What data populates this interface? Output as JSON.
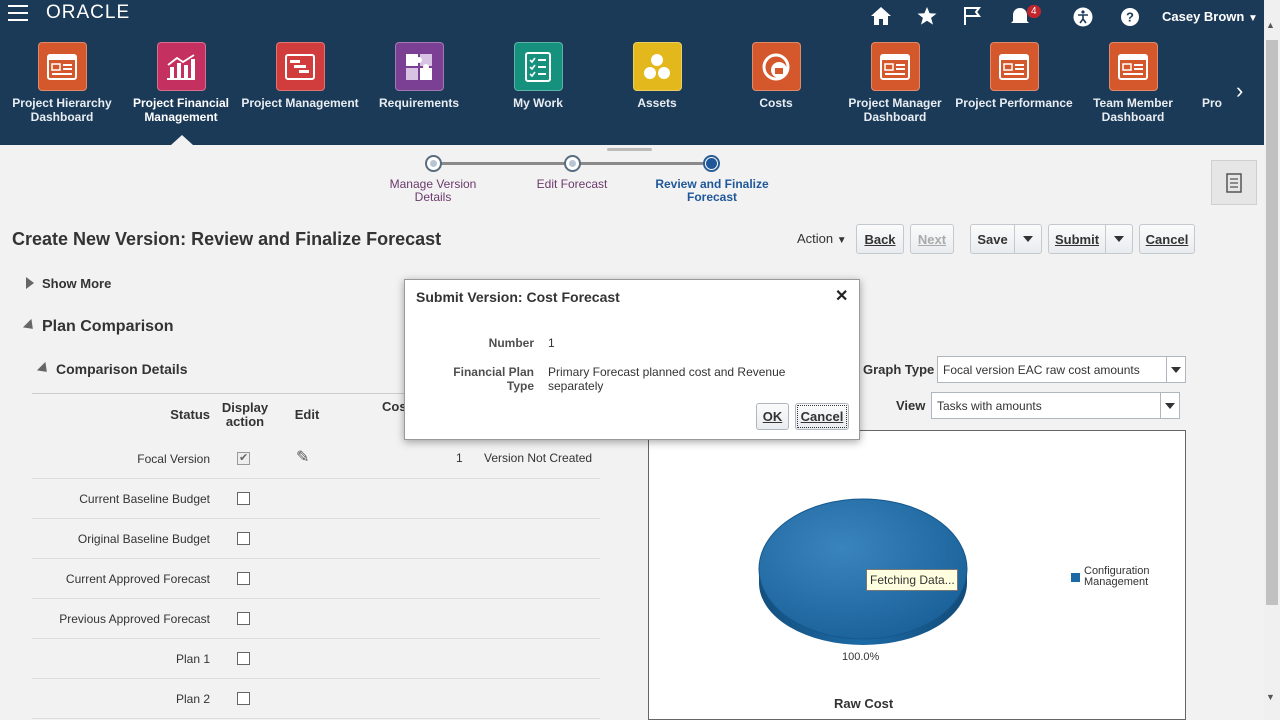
{
  "header": {
    "brand": "ORACLE",
    "user_name": "Casey Brown",
    "notifications_count": "4",
    "springboard": [
      {
        "label": "Project Hierarchy Dashboard",
        "icon": "dashboard-icon",
        "color": "#d4582c"
      },
      {
        "label": "Project Financial Management",
        "icon": "chart-icon",
        "color": "#c4305f"
      },
      {
        "label": "Project Management",
        "icon": "gantt-icon",
        "color": "#d13c3c"
      },
      {
        "label": "Requirements",
        "icon": "puzzle-icon",
        "color": "#7b3f93"
      },
      {
        "label": "My Work",
        "icon": "checklist-icon",
        "color": "#16917d"
      },
      {
        "label": "Assets",
        "icon": "assets-icon",
        "color": "#e3b81d"
      },
      {
        "label": "Costs",
        "icon": "costs-icon",
        "color": "#d4582c"
      },
      {
        "label": "Project Manager Dashboard",
        "icon": "dashboard-icon",
        "color": "#d4582c"
      },
      {
        "label": "Project Performance",
        "icon": "dashboard-icon",
        "color": "#d4582c"
      },
      {
        "label": "Team Member Dashboard",
        "icon": "dashboard-icon",
        "color": "#d4582c"
      },
      {
        "label": "Pro",
        "icon": "",
        "color": ""
      }
    ]
  },
  "train": {
    "steps": [
      "Manage Version Details",
      "Edit Forecast",
      "Review and Finalize Forecast"
    ]
  },
  "page": {
    "title": "Create New Version: Review and Finalize Forecast",
    "toolbar": {
      "action": "Action",
      "back": "Back",
      "next": "Next",
      "save": "Save",
      "submit": "Submit",
      "cancel": "Cancel"
    },
    "show_more": "Show More",
    "plan_comparison": "Plan Comparison",
    "comparison_details": "Comparison Details"
  },
  "table": {
    "headers": {
      "status": "Status",
      "display_action": "Display action",
      "edit": "Edit",
      "cost": "Cos"
    },
    "rows": [
      {
        "name": "Focal Version",
        "checked": true,
        "number": "1",
        "status": "Version Not Created"
      },
      {
        "name": "Current Baseline Budget",
        "checked": false
      },
      {
        "name": "Original Baseline Budget",
        "checked": false
      },
      {
        "name": "Current Approved Forecast",
        "checked": false
      },
      {
        "name": "Previous Approved Forecast",
        "checked": false
      },
      {
        "name": "Plan 1",
        "checked": false
      },
      {
        "name": "Plan 2",
        "checked": false
      }
    ]
  },
  "graph": {
    "graph_type_label": "Graph Type",
    "graph_type_value": "Focal version EAC raw cost amounts",
    "view_label": "View",
    "view_value": "Tasks with amounts",
    "fetching": "Fetching Data...",
    "title": "Raw Cost"
  },
  "chart_data": {
    "type": "pie",
    "title": "Raw Cost",
    "categories": [
      "Configuration Management"
    ],
    "values": [
      100.0
    ],
    "data_labels": [
      "100.0%"
    ],
    "legend": "right",
    "colors": [
      "#1b6aa7"
    ]
  },
  "dialog": {
    "title": "Submit Version: Cost Forecast",
    "number_label": "Number",
    "number_value": "1",
    "plan_type_label": "Financial Plan Type",
    "plan_type_value": "Primary Forecast planned cost and Revenue separately",
    "ok": "OK",
    "cancel": "Cancel"
  }
}
